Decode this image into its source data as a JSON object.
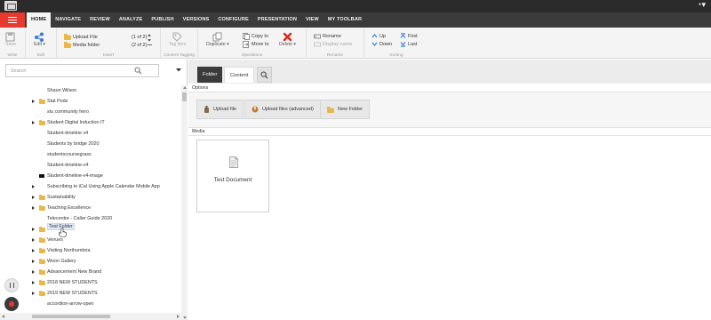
{
  "menubar": {
    "tabs": [
      {
        "label": "HOME",
        "active": true
      },
      {
        "label": "NAVIGATE"
      },
      {
        "label": "REVIEW"
      },
      {
        "label": "ANALYZE"
      },
      {
        "label": "PUBLISH"
      },
      {
        "label": "VERSIONS"
      },
      {
        "label": "CONFIGURE"
      },
      {
        "label": "PRESENTATION"
      },
      {
        "label": "VIEW"
      },
      {
        "label": "MY TOOLBAR"
      }
    ]
  },
  "ribbon": {
    "write": {
      "save": "Save",
      "label": "Write"
    },
    "edit": {
      "edit": "Edit ▾",
      "label": "Edit"
    },
    "insert": {
      "items": [
        {
          "label": "Upload File",
          "count": "(1 of 2)",
          "icon": "upload-file-icon"
        },
        {
          "label": "Media folder",
          "count": "(2 of 2)",
          "icon": "media-folder-icon"
        }
      ],
      "label": "Insert"
    },
    "tagging": {
      "tag_item": "Tag item",
      "label": "Content Tagging"
    },
    "operations": {
      "duplicate": "Duplicate ▾",
      "copy_to": "Copy to",
      "move_to": "Move to",
      "delete": "Delete ▾",
      "label": "Operations"
    },
    "rename": {
      "rename": "Rename",
      "display_name": "Display name",
      "label": "Rename"
    },
    "sorting": {
      "up": "Up",
      "first": "First",
      "down": "Down",
      "last": "Last",
      "label": "Sorting"
    }
  },
  "search": {
    "placeholder": "Search"
  },
  "tree": [
    {
      "label": "Shaun Wilson",
      "icon": "none",
      "arrow": false
    },
    {
      "label": "Stat Pods",
      "icon": "folder",
      "arrow": true
    },
    {
      "label": "stu community hero",
      "icon": "none",
      "arrow": false
    },
    {
      "label": "Student Digital Induction IT",
      "icon": "folder",
      "arrow": true
    },
    {
      "label": "Student-timeline v4",
      "icon": "none",
      "arrow": false
    },
    {
      "label": "Students by bridge 2020",
      "icon": "none",
      "arrow": false
    },
    {
      "label": "studentscoursegrass",
      "icon": "none",
      "arrow": false
    },
    {
      "label": "Student-timeline-v4",
      "icon": "none",
      "arrow": false
    },
    {
      "label": "Student-timeline-v4-image",
      "icon": "black",
      "arrow": false
    },
    {
      "label": "Subscribing to iCal Using Apple Calendar Mobile App",
      "icon": "none",
      "arrow": true
    },
    {
      "label": "Sustainability",
      "icon": "folder",
      "arrow": true
    },
    {
      "label": "Teaching Excellence",
      "icon": "folder",
      "arrow": true
    },
    {
      "label": "Telecentre - Caller Guide 2020",
      "icon": "none",
      "arrow": false
    },
    {
      "label": "Test Folder",
      "icon": "folder",
      "arrow": true,
      "selected": true
    },
    {
      "label": "Venues",
      "icon": "folder",
      "arrow": true
    },
    {
      "label": "Visiting Northumbria",
      "icon": "folder",
      "arrow": true
    },
    {
      "label": "Woon Gallery",
      "icon": "folder",
      "arrow": true
    },
    {
      "label": "Advancement New Brand",
      "icon": "folder",
      "arrow": true
    },
    {
      "label": "2018 NEW STUDENTS",
      "icon": "folder",
      "arrow": true
    },
    {
      "label": "2019 NEW STUDENTS",
      "icon": "folder",
      "arrow": true
    },
    {
      "label": "accordion-arrow-open",
      "icon": "none",
      "arrow": false
    },
    {
      "label": "Amsterdam 2020",
      "icon": "folder",
      "arrow": true
    }
  ],
  "content": {
    "tabs": {
      "folder": "Folder",
      "content": "Content"
    },
    "options_label": "Options",
    "buttons": {
      "upload_file": "Upload file",
      "upload_files_advanced": "Upload files (advanced)",
      "new_folder": "New Folder"
    },
    "media_label": "Media",
    "media_items": [
      {
        "name": "Test Document",
        "icon": "document-icon"
      }
    ]
  },
  "colors": {
    "accent": "#e63a2f",
    "menubar": "#3b3b3b",
    "topbar": "#2b2b2b",
    "folder": "#e8b84a"
  }
}
